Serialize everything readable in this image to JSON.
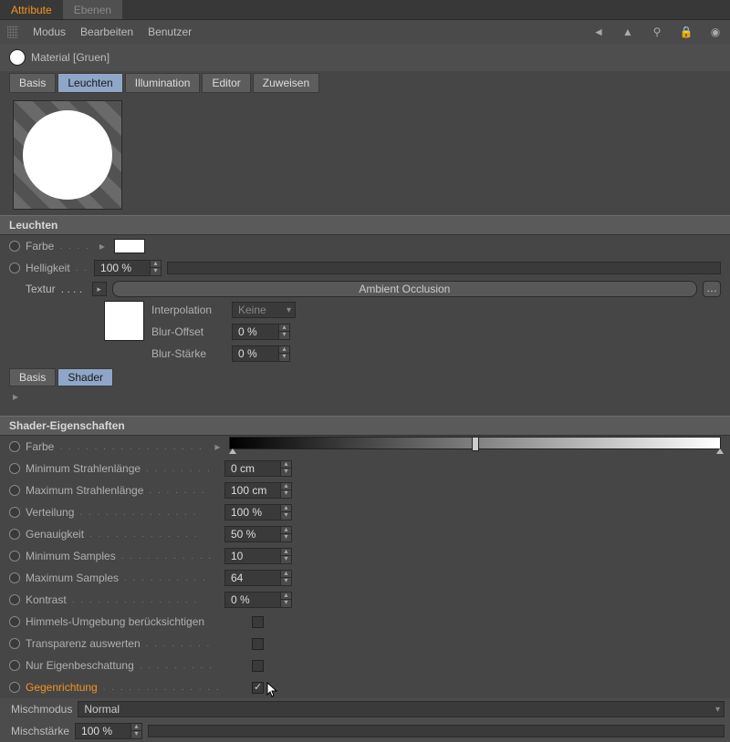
{
  "topTabs": {
    "attribute": "Attribute",
    "ebenen": "Ebenen"
  },
  "menu": {
    "modus": "Modus",
    "bearbeiten": "Bearbeiten",
    "benutzer": "Benutzer"
  },
  "material": {
    "title": "Material [Gruen]"
  },
  "channelTabs": {
    "basis": "Basis",
    "leuchten": "Leuchten",
    "illumination": "Illumination",
    "editor": "Editor",
    "zuweisen": "Zuweisen"
  },
  "section": {
    "leuchten": "Leuchten",
    "shaderProps": "Shader-Eigenschaften"
  },
  "props": {
    "farbe": "Farbe",
    "helligkeit": "Helligkeit",
    "helligkeitVal": "100 %",
    "textur": "Textur",
    "texturVal": "Ambient Occlusion",
    "interpolation": "Interpolation",
    "interpolationVal": "Keine",
    "blurOffset": "Blur-Offset",
    "blurOffsetVal": "0 %",
    "blurStaerke": "Blur-Stärke",
    "blurStaerkeVal": "0 %"
  },
  "subTabs": {
    "basis": "Basis",
    "shader": "Shader"
  },
  "shader": {
    "farbe": "Farbe",
    "minStrahl": "Minimum Strahlenlänge",
    "minStrahlVal": "0 cm",
    "maxStrahl": "Maximum Strahlenlänge",
    "maxStrahlVal": "100 cm",
    "verteilung": "Verteilung",
    "verteilungVal": "100 %",
    "genauigkeit": "Genauigkeit",
    "genauigkeitVal": "50 %",
    "minSamples": "Minimum Samples",
    "minSamplesVal": "10",
    "maxSamples": "Maximum Samples",
    "maxSamplesVal": "64",
    "kontrast": "Kontrast",
    "kontrastVal": "0 %",
    "himmel": "Himmels-Umgebung berücksichtigen",
    "transparenz": "Transparenz auswerten",
    "eigen": "Nur Eigenbeschattung",
    "gegen": "Gegenrichtung"
  },
  "mix": {
    "modus": "Mischmodus",
    "modusVal": "Normal",
    "staerke": "Mischstärke",
    "staerkeVal": "100 %"
  }
}
